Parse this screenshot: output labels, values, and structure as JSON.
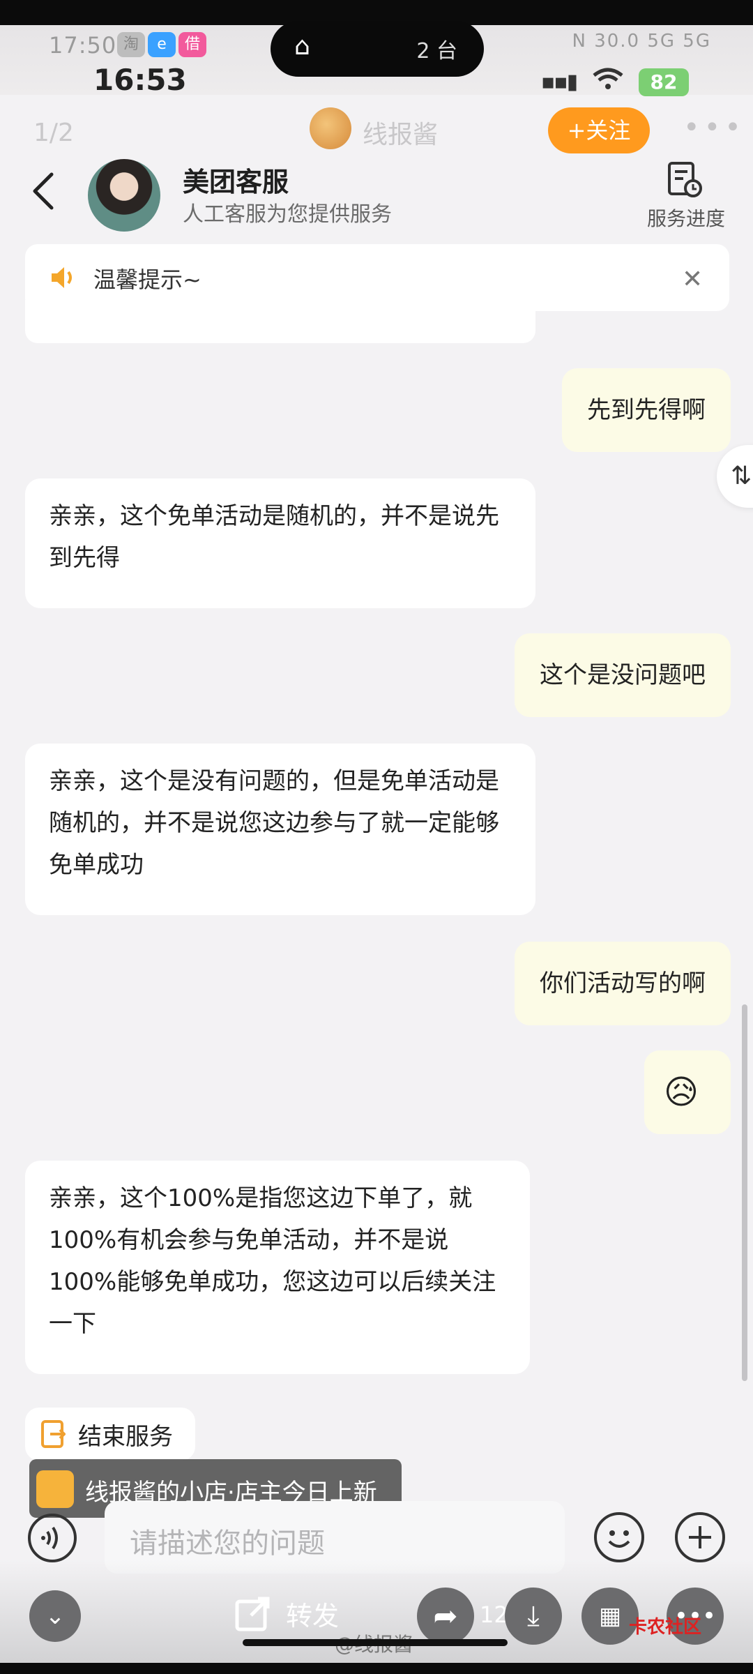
{
  "outer_status": {
    "time": "17:50",
    "app1": "淘",
    "app2": "e",
    "app3": "借",
    "island_count": "2 台",
    "right_indicators": "N 30.0 5G 5G"
  },
  "status_bar": {
    "time": "16:53",
    "signal": "▪▪▮",
    "wifi": "((·))",
    "battery": "82"
  },
  "viewer": {
    "page_indicator": "1/2",
    "author_name": "线报酱",
    "follow_label": "+关注",
    "more": "•••"
  },
  "chat_header": {
    "title": "美团客服",
    "subtitle": "人工客服为您提供服务",
    "progress_label": "服务进度"
  },
  "notice": {
    "text": "温馨提示~",
    "close": "✕"
  },
  "messages": [
    {
      "side": "right",
      "text": "先到先得啊"
    },
    {
      "side": "left",
      "text": "亲亲，这个免单活动是随机的，并不是说先到先得"
    },
    {
      "side": "right",
      "text": "这个是没问题吧"
    },
    {
      "side": "left",
      "text": "亲亲，这个是没有问题的，但是免单活动是随机的，并不是说您这边参与了就一定能够免单成功"
    },
    {
      "side": "right",
      "text": "你们活动写的啊"
    },
    {
      "side": "right",
      "text": "😥"
    },
    {
      "side": "left",
      "text": "亲亲，这个100%是指您这边下单了，就100%有机会参与免单活动，并不是说100%能够免单成功，您这边可以后续关注一下"
    }
  ],
  "float_toggle": "⇅",
  "end_service_label": "结束服务",
  "shop_toast": "线报酱的小店·店主今日上新",
  "input": {
    "placeholder": "请描述您的问题"
  },
  "bottom_bar": {
    "repost_label": "转发",
    "share_count": "12",
    "watermark": "@线报酱",
    "site_watermark": "卡农社区"
  }
}
